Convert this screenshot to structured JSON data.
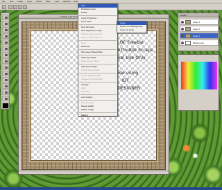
{
  "app": {
    "doc_title": "Untitled-1 @ 16.7% (Layer 1, RGB/8)"
  },
  "menubar": [
    "File",
    "Edit",
    "Image",
    "Layer",
    "Select",
    "Filter",
    "View",
    "Window",
    "Help"
  ],
  "layer_menu": {
    "items": [
      {
        "label": "New",
        "state": "highlighted"
      },
      {
        "label": "Duplicate Layer...",
        "state": "normal"
      },
      {
        "label": "Delete",
        "state": "normal"
      },
      {
        "sep": true
      },
      {
        "label": "Layer Properties...",
        "state": "normal"
      },
      {
        "label": "Layer Style",
        "state": "normal"
      },
      {
        "sep": true
      },
      {
        "label": "New Fill Layer",
        "state": "normal"
      },
      {
        "label": "New Adjustment Layer",
        "state": "normal"
      },
      {
        "label": "Change Layer Content",
        "state": "disabled"
      },
      {
        "label": "Layer Content Options...",
        "state": "disabled"
      },
      {
        "sep": true
      },
      {
        "label": "Type",
        "state": "disabled"
      },
      {
        "label": "Rasterize",
        "state": "normal"
      },
      {
        "sep": true
      },
      {
        "label": "New Layer Based Slice",
        "state": "normal"
      },
      {
        "sep": true
      },
      {
        "label": "Add Layer Mask",
        "state": "normal"
      },
      {
        "label": "Enable Layer Mask",
        "state": "disabled"
      },
      {
        "sep": true
      },
      {
        "label": "Add Vector Mask",
        "state": "normal"
      },
      {
        "label": "Enable Vector Mask",
        "state": "disabled"
      },
      {
        "sep": true
      },
      {
        "label": "Create Clipping Mask",
        "state": "disabled"
      },
      {
        "label": "Release Clipping Mask",
        "state": "disabled"
      },
      {
        "sep": true
      },
      {
        "label": "Arrange",
        "state": "normal"
      },
      {
        "label": "Align",
        "state": "disabled"
      },
      {
        "label": "Distribute",
        "state": "disabled"
      },
      {
        "sep": true
      },
      {
        "label": "Lock Layers...",
        "state": "normal"
      },
      {
        "sep": true
      },
      {
        "label": "Merge Layers",
        "state": "disabled"
      },
      {
        "label": "Merge Visible",
        "state": "normal"
      },
      {
        "label": "Flatten Image",
        "state": "normal"
      },
      {
        "sep": true
      },
      {
        "label": "Matting",
        "state": "normal"
      }
    ]
  },
  "new_submenu": {
    "items": [
      {
        "label": "Layer...",
        "state": "highlighted"
      },
      {
        "label": "Layer From Background...",
        "state": "normal"
      },
      {
        "label": "Layer via Copy",
        "state": "normal"
      }
    ]
  },
  "document": {
    "lines": [
      "KIND OF Freebie",
      "by DoubleTrouble Scraps",
      "Personal Use Only",
      "",
      "Made using",
      "KIT",
      "by DESIGNER"
    ]
  },
  "layers_panel": {
    "title": "Layers",
    "rows": [
      {
        "name": "Layer 3"
      },
      {
        "name": "Layer 2"
      },
      {
        "name": "Layer 1"
      },
      {
        "name": "Background"
      }
    ]
  }
}
